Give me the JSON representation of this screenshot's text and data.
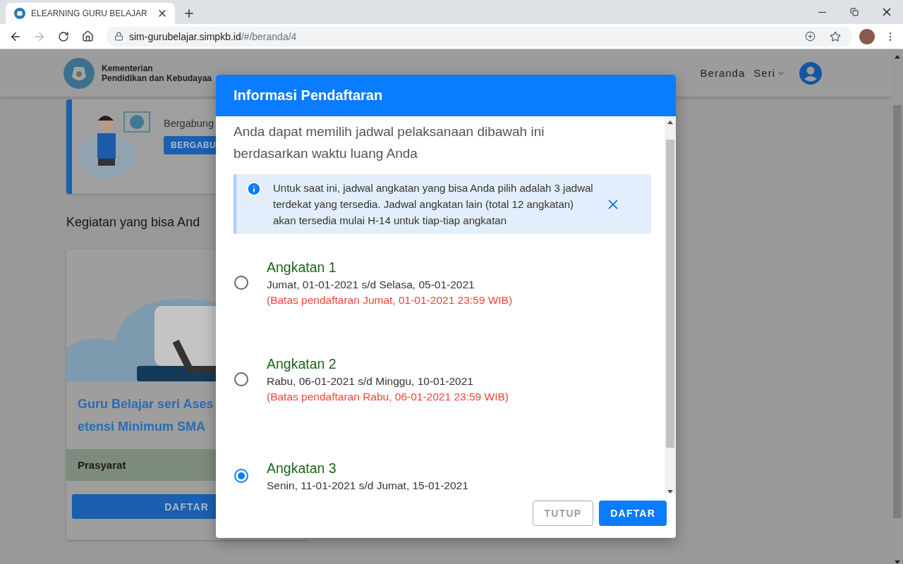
{
  "browser": {
    "tab_title": "ELEARNING GURU BELAJAR",
    "url_host": "sim-gurubelajar.simpkb.id",
    "url_path": "/#/beranda/4"
  },
  "header": {
    "ministry_line1": "Kementerian",
    "ministry_line2": "Pendidikan dan Kebudayaa",
    "nav": [
      {
        "label": "Beranda",
        "has_menu": false
      },
      {
        "label": "Seri",
        "has_menu": true
      }
    ]
  },
  "banner": {
    "text": "Bergabung",
    "button": "BERGABU"
  },
  "section_title": "Kegiatan yang bisa And",
  "course": {
    "title_lines": [
      "Guru Belajar seri Ases",
      "etensi Minimum SMA"
    ],
    "prerequisite": "Prasyarat",
    "button": "DAFTAR"
  },
  "modal": {
    "title": "Informasi Pendaftaran",
    "intro": "Anda dapat memilih jadwal pelaksanaan dibawah ini berdasarkan waktu luang Anda",
    "alert": "Untuk saat ini, jadwal angkatan yang bisa Anda pilih adalah 3 jadwal terdekat yang tersedia. Jadwal angkatan lain (total 12 angkatan) akan tersedia mulai H-14 untuk tiap-tiap angkatan",
    "options": [
      {
        "title": "Angkatan 1",
        "dates": "Jumat, 01-01-2021 s/d Selasa, 05-01-2021",
        "deadline": "(Batas pendaftaran Jumat, 01-01-2021 23:59 WIB)",
        "selected": false
      },
      {
        "title": "Angkatan 2",
        "dates": "Rabu, 06-01-2021 s/d Minggu, 10-01-2021",
        "deadline": "(Batas pendaftaran Rabu, 06-01-2021 23:59 WIB)",
        "selected": false
      },
      {
        "title": "Angkatan 3",
        "dates": "Senin, 11-01-2021 s/d Jumat, 15-01-2021",
        "selected": true
      }
    ],
    "buttons": [
      {
        "label": "TUTUP",
        "kind": "outline"
      },
      {
        "label": "DAFTAR",
        "kind": "primary"
      }
    ]
  }
}
